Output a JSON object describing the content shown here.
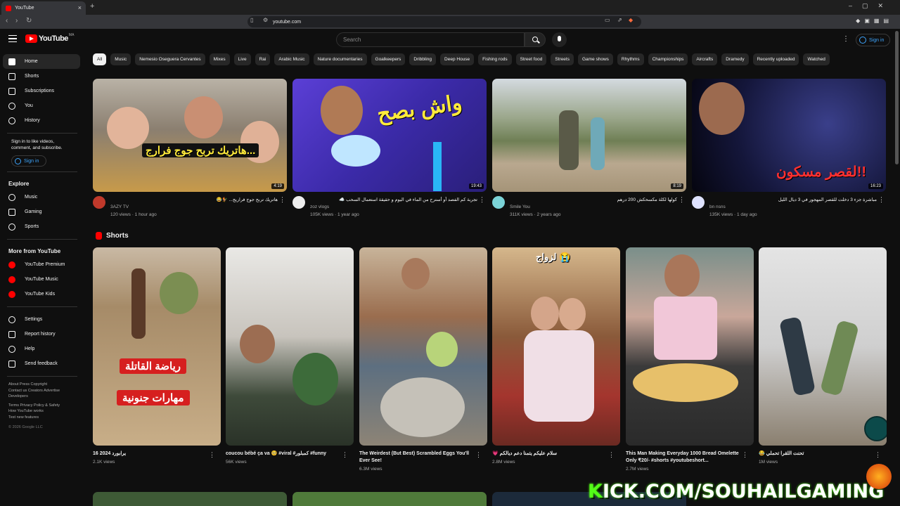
{
  "browser": {
    "tab_title": "YouTube",
    "url": "youtube.com"
  },
  "header": {
    "logo_text": "YouTube",
    "logo_country": "MA",
    "search_placeholder": "Search",
    "signin_label": "Sign in"
  },
  "sidebar": {
    "primary": [
      {
        "label": "Home",
        "icon": "home-icon"
      },
      {
        "label": "Shorts",
        "icon": "shorts-icon"
      },
      {
        "label": "Subscriptions",
        "icon": "subscriptions-icon"
      },
      {
        "label": "You",
        "icon": "you-icon"
      },
      {
        "label": "History",
        "icon": "history-icon"
      }
    ],
    "signin_note": "Sign in to like videos, comment, and subscribe.",
    "signin_label": "Sign in",
    "explore_title": "Explore",
    "explore": [
      {
        "label": "Music",
        "icon": "music-icon"
      },
      {
        "label": "Gaming",
        "icon": "gaming-icon"
      },
      {
        "label": "Sports",
        "icon": "sports-icon"
      }
    ],
    "more_title": "More from YouTube",
    "more": [
      {
        "label": "YouTube Premium",
        "icon": "youtube-premium-icon"
      },
      {
        "label": "YouTube Music",
        "icon": "youtube-music-icon"
      },
      {
        "label": "YouTube Kids",
        "icon": "youtube-kids-icon"
      }
    ],
    "settings": [
      {
        "label": "Settings",
        "icon": "gear-icon"
      },
      {
        "label": "Report history",
        "icon": "flag-icon"
      },
      {
        "label": "Help",
        "icon": "help-icon"
      },
      {
        "label": "Send feedback",
        "icon": "feedback-icon"
      }
    ],
    "footer_line1": "About  Press  Copyright",
    "footer_line2": "Contact us  Creators  Advertise",
    "footer_line3": "Developers",
    "footer_line4": "Terms  Privacy  Policy & Safety",
    "footer_line5": "How YouTube works",
    "footer_line6": "Test new features",
    "copyright": "© 2026 Google LLC"
  },
  "chips": [
    "All",
    "Music",
    "Nemesio Oseguera Cervantes",
    "Mixes",
    "Live",
    "Rai",
    "Arabic Music",
    "Nature documentaries",
    "Goalkeepers",
    "Dribbling",
    "Deep House",
    "Fishing rods",
    "Street food",
    "Streets",
    "Game shows",
    "Rhythms",
    "Championships",
    "Aircrafts",
    "Dramedy",
    "Recently uploaded",
    "Watched"
  ],
  "videos": [
    {
      "title": "هاتريك تربح جوج فراريج... 🐓😂",
      "thumb_text": "هاتريك تربح جوج فرارج...",
      "channel": "3AZY TV",
      "views": "120 views · 1 hour ago",
      "duration": "4:19"
    },
    {
      "title": "تجربة كم الفصد أو أسترح من الماء في اليوم و حقيقة استعمال السحب ☁️",
      "thumb_text": "واش بصح",
      "channel": "zoz vlogs",
      "views": "105K views · 1 year ago",
      "duration": "19:43"
    },
    {
      "title": "كولها لكلة مكسحكش 200 درهم",
      "thumb_text": "",
      "channel": "Smile You",
      "views": "311K views · 2 years ago",
      "duration": "8:19"
    },
    {
      "title": "مباشرة جزء 3 دخلت للقصر المهجور في 3 ديال الليل",
      "thumb_text": "لقصر مسكون!!",
      "channel": "bn nsns",
      "views": "135K views · 1 day ago",
      "duration": "16:23"
    }
  ],
  "shorts_title": "Shorts",
  "shorts": [
    {
      "title": "يرابورد 2024 16",
      "views": "2.1K views",
      "label1": "رياضة القاتلة",
      "label2": "مهارات جنونية"
    },
    {
      "title": "coucou bébé ça va 🥺 #viral #كمبلور #funny",
      "views": "56K views"
    },
    {
      "title": "The Weirdest (But Best) Scrambled Eggs You'll Ever See!",
      "views": "6.3M views"
    },
    {
      "title": "💗 سلام عليكم يتمنا دعم ديالكم",
      "views": "2.8M views",
      "label1": "لزواج 😭"
    },
    {
      "title": "This Man Making Everyday 1000  Bread Omelette Only ₹20/- #shorts #youtubeshort...",
      "views": "2.7M views"
    },
    {
      "title": "😂 تحنت اللقرا تحملي",
      "views": "1M views"
    }
  ],
  "overlay": {
    "kick_prefix": "K",
    "kick_rest": "ICK.COM/SOUHAILGAMING"
  },
  "colors": {
    "accent": "#ff0000",
    "link": "#3ea6ff",
    "background": "#0f0f0f",
    "kick_green": "#53fc18"
  }
}
